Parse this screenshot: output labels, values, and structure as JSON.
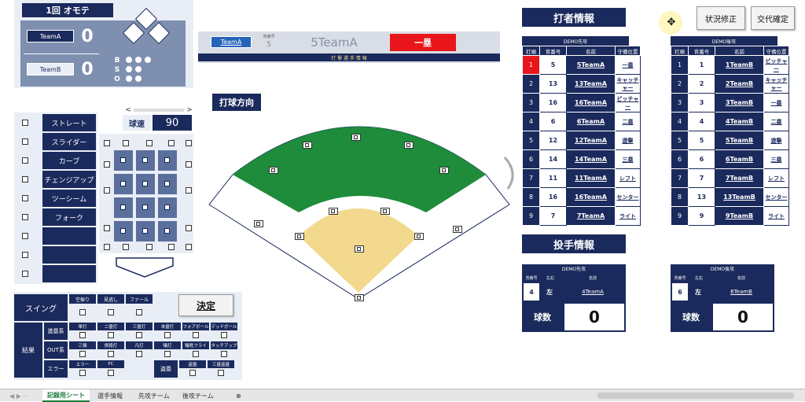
{
  "scoreboard": {
    "inning": "1回 オモテ",
    "team_a": "TeamA",
    "team_a_score": "0",
    "team_b": "TeamB",
    "team_b_score": "0",
    "bso_labels": [
      "B",
      "S",
      "O"
    ]
  },
  "banner": {
    "team_tag": "TeamA",
    "small_label": "背番号",
    "number": "5",
    "player": "5TeamA",
    "base": "一塁",
    "caption": "打 撃 選 手 情 報"
  },
  "batting_direction_label": "打球方向",
  "pitch_types": [
    "ストレート",
    "スライダー",
    "カーブ",
    "チェンジアップ",
    "ツーシーム",
    "フォーク",
    "",
    "",
    ""
  ],
  "speed": {
    "label": "球速",
    "value": "90",
    "prev": "<",
    "next": ">"
  },
  "result_panel": {
    "swing": "スイング",
    "swing_options": [
      "空振り",
      "見逃し",
      "ファール"
    ],
    "kettei": "決定",
    "result": "結果",
    "shinrui": "進塁系",
    "shinrui_options": [
      "単打",
      "二塁打",
      "三塁打",
      "本塁打",
      "フォアボール",
      "デッドボール"
    ],
    "out": "OUT系",
    "out_options": [
      "三振",
      "併殺打",
      "凡打",
      "犠打",
      "犠牲フライ",
      "タッチアップ"
    ],
    "error": "エラー",
    "error_options": [
      "エラー",
      "FC"
    ],
    "steal": "盗塁",
    "steal_options": [
      "盗塁",
      "三塁盗塁"
    ]
  },
  "batter_info": {
    "title": "打者情報",
    "btn_fix": "状況修正",
    "btn_swap": "交代確定"
  },
  "lineup_headers": [
    "打順",
    "背番号",
    "名前",
    "守備位置"
  ],
  "lineup_a": {
    "team": "DEMO先攻",
    "rows": [
      [
        "1",
        "5",
        "5TeamA",
        "一塁"
      ],
      [
        "2",
        "13",
        "13TeamA",
        "キャッチャー"
      ],
      [
        "3",
        "16",
        "16TeamA",
        "ピッチャー"
      ],
      [
        "4",
        "6",
        "6TeamA",
        "二塁"
      ],
      [
        "5",
        "12",
        "12TeamA",
        "遊撃"
      ],
      [
        "6",
        "14",
        "14TeamA",
        "三塁"
      ],
      [
        "7",
        "11",
        "11TeamA",
        "レフト"
      ],
      [
        "8",
        "16",
        "16TeamA",
        "センター"
      ],
      [
        "9",
        "7",
        "7TeamA",
        "ライト"
      ]
    ]
  },
  "lineup_b": {
    "team": "DEMO後攻",
    "rows": [
      [
        "1",
        "1",
        "1TeamB",
        "ピッチャー"
      ],
      [
        "2",
        "2",
        "2TeamB",
        "キャッチャー"
      ],
      [
        "3",
        "3",
        "3TeamB",
        "一塁"
      ],
      [
        "4",
        "4",
        "4TeamB",
        "二塁"
      ],
      [
        "5",
        "5",
        "5TeamB",
        "遊撃"
      ],
      [
        "6",
        "6",
        "6TeamB",
        "三塁"
      ],
      [
        "7",
        "7",
        "7TeamB",
        "レフト"
      ],
      [
        "8",
        "13",
        "13TeamB",
        "センター"
      ],
      [
        "9",
        "9",
        "9TeamB",
        "ライト"
      ]
    ]
  },
  "pitcher_info": {
    "title": "投手情報",
    "headers": [
      "背番号",
      "左右",
      "名前"
    ],
    "a": {
      "team": "DEMO先攻",
      "number": "4",
      "hand": "左",
      "name": "4TeamA",
      "count_label": "球数",
      "count": "0"
    },
    "b": {
      "team": "DEMO後攻",
      "number": "6",
      "hand": "左",
      "name": "6TeamB",
      "count_label": "球数",
      "count": "0"
    }
  },
  "sheet_tabs": [
    "記録用シート",
    "選手情報",
    "先攻チーム",
    "後攻チーム"
  ],
  "colors": {
    "navy": "#1b2a5c",
    "field_green": "#1e8c3a",
    "infield": "#f3d98d",
    "red": "#e8161a",
    "highlight": "#e8161a"
  }
}
